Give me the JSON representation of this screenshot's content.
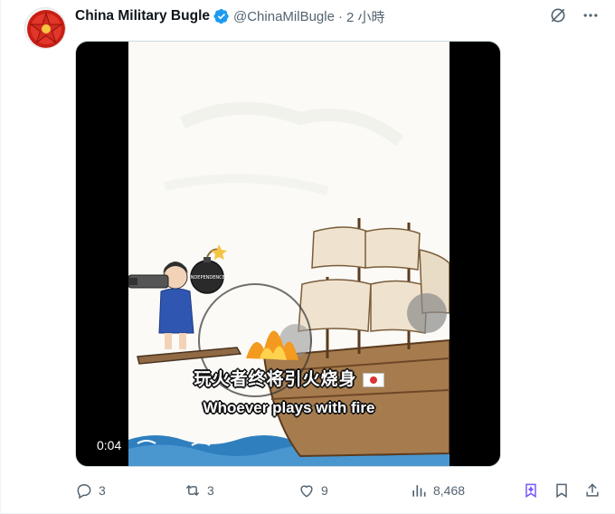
{
  "tweet": {
    "display_name": "China Military Bugle",
    "handle": "@ChinaMilBugle",
    "separator": "·",
    "time": "2 小時",
    "avatar_icon": "red-star-emblem",
    "verified_icon": "verified-badge",
    "colors": {
      "verified": "#1d9bf0",
      "secondary_text": "#536471",
      "avatar_star": "#d42a1f",
      "grok_icon": "#7856ff"
    }
  },
  "media": {
    "subtitle_cn": "玩火者终将引火烧身",
    "subtitle_en": "Whoever plays with fire",
    "bomb_label": "INDEPENDENCE",
    "timestamp": "0:04",
    "progress_fraction": 0.0
  },
  "actions": {
    "reply_count": "3",
    "repost_count": "3",
    "like_count": "9",
    "view_count": "8,468"
  }
}
